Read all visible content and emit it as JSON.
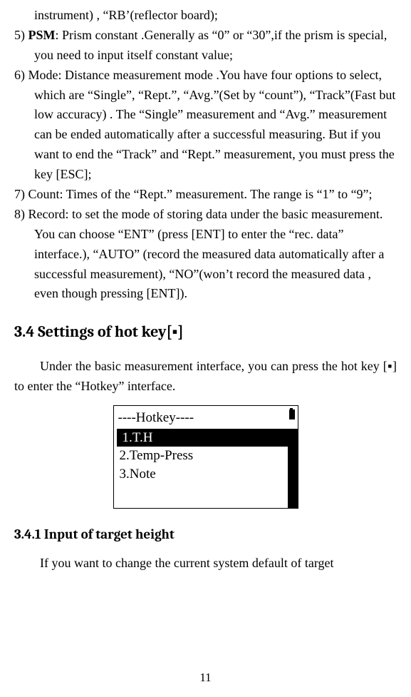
{
  "items": {
    "continuation": "instrument) , “RB’(reflector board);",
    "item5_label": "5) ",
    "item5_psm": "PSM",
    "item5_text": ": Prism constant .Generally as “0” or “30”,if the prism is special, you need to input itself constant value;",
    "item6": "6) Mode: Distance measurement mode .You have four options to select, which are “Single”, “Rept.”, “Avg.”(Set by “count”), “Track”(Fast but low accuracy) . The “Single” measurement and “Avg.” measurement can be ended automatically after a successful measuring. But if you want to end the “Track” and “Rept.” measurement, you must press the key [ESC];",
    "item7": "7) Count: Times of the “Rept.” measurement. The range is “1” to “9”;",
    "item8": "8) Record: to set the mode of storing data under the basic measurement. You can choose “ENT” (press [ENT] to enter the “rec. data” interface.), “AUTO” (record the measured data automatically after a successful measurement), “NO”(won’t record the measured data , even though pressing [ENT])."
  },
  "section_3_4": {
    "heading": "3.4 Settings of hot key[▪]",
    "body": "Under the basic measurement interface, you can press the hot key [▪] to enter the “Hotkey” interface."
  },
  "screen": {
    "title": "----Hotkey----",
    "items": [
      {
        "label": "1.T.H",
        "selected": true
      },
      {
        "label": "2.Temp-Press",
        "selected": false
      },
      {
        "label": "3.Note",
        "selected": false
      }
    ]
  },
  "section_3_4_1": {
    "heading": "3.4.1 Input of target height",
    "body": "If you want to change the current system default of target"
  },
  "page_number": "11"
}
